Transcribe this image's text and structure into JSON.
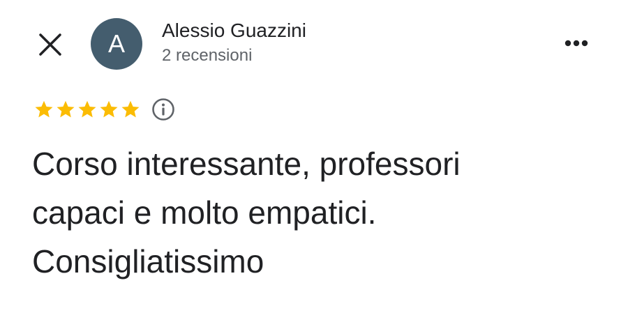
{
  "header": {
    "close_icon": "close-icon",
    "avatar_letter": "A",
    "avatar_color": "#445d6e",
    "reviewer_name": "Alessio Guazzini",
    "review_count": "2 recensioni",
    "more_icon": "more-horizontal-icon"
  },
  "review": {
    "rating": 5,
    "rating_max": 5,
    "star_color": "#fbbc04",
    "info_icon": "info-icon",
    "text_lines": [
      "Corso interessante, professori",
      "capaci e molto empatici.",
      "Consigliatissimo"
    ]
  }
}
